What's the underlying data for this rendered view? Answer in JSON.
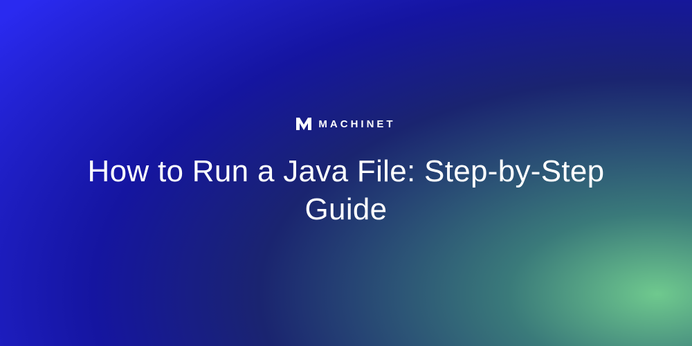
{
  "brand": {
    "name": "MACHINET",
    "icon": "machinet-logo"
  },
  "hero": {
    "title": "How to Run a Java File: Step-by-Step Guide"
  },
  "colors": {
    "gradient_start": "#2a2af0",
    "gradient_mid": "#1a2470",
    "gradient_end": "#6fc98e",
    "text": "#ffffff"
  }
}
